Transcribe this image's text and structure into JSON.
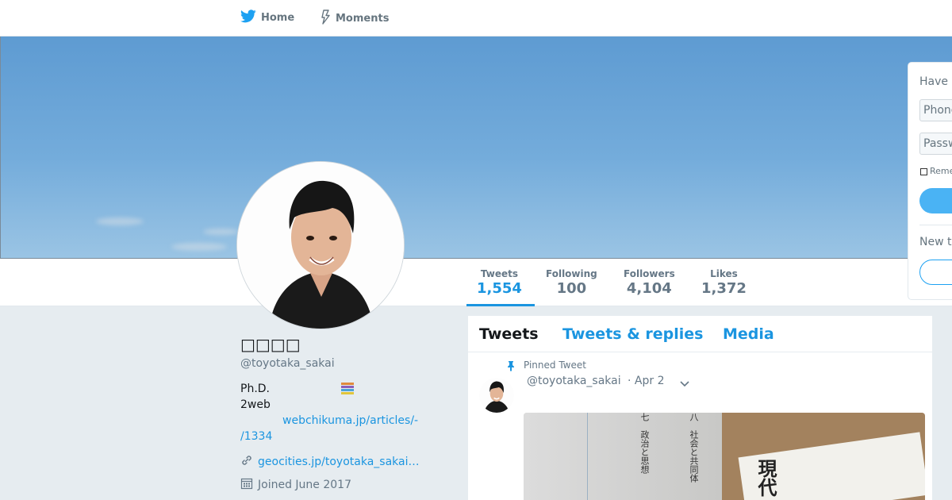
{
  "nav": {
    "home_label": "Home",
    "moments_label": "Moments"
  },
  "profile": {
    "name": "□□□□",
    "handle": "@toyotaka_sakai",
    "bio_line1": "Ph.D.",
    "bio_line2": "2web",
    "bio_link": "webchikuma.jp/articles/-/1334",
    "bio_link_part1": "webchikuma.jp/articles/-",
    "bio_link_part2": "/1334",
    "website": "geocities.jp/toyotaka_sakai…",
    "joined": "Joined June 2017"
  },
  "stats": [
    {
      "label": "Tweets",
      "value": "1,554"
    },
    {
      "label": "Following",
      "value": "100"
    },
    {
      "label": "Followers",
      "value": "4,104"
    },
    {
      "label": "Likes",
      "value": "1,372"
    }
  ],
  "timeline": {
    "tabs": [
      "Tweets",
      "Tweets & replies",
      "Media"
    ],
    "pinned_label": "Pinned Tweet",
    "tweet_handle": "@toyotaka_sakai",
    "tweet_date": "· Apr 2",
    "image_text": {
      "col1": "七　政治と思想",
      "col2": "八　社会と共同体",
      "book_title": "現代"
    }
  },
  "login": {
    "title": "Have",
    "phone_placeholder": "Phone",
    "password_placeholder": "Passw",
    "remember": "Reme",
    "new_to": "New t"
  },
  "colors": {
    "accent": "#1b95e0",
    "twitter_blue": "#1da1f2",
    "background": "#e6ecf0"
  },
  "icons": {
    "home": "twitter-bird-icon",
    "moments": "lightning-icon",
    "pin": "pin-icon",
    "link": "link-icon",
    "calendar": "calendar-icon",
    "books": "books-emoji-icon",
    "caret": "chevron-down-icon"
  }
}
